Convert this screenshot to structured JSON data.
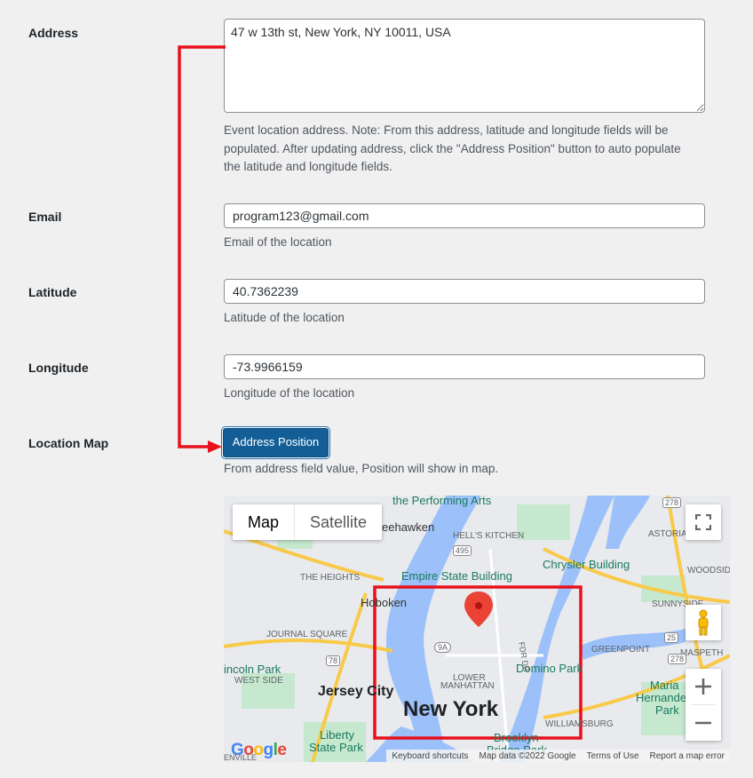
{
  "address": {
    "label": "Address",
    "value": "47 w 13th st, New York, NY 10011, USA",
    "desc_lines": [
      "Event location address. Note: From this address, latitude and longitude fields will be",
      "populated. After updating address, click the \"Address Position\" button to auto populate",
      "the latitude and longitude fields."
    ]
  },
  "email": {
    "label": "Email",
    "value": "program123@gmail.com",
    "desc": "Email of the location"
  },
  "latitude": {
    "label": "Latitude",
    "value": "40.7362239",
    "desc": "Latitude of the location"
  },
  "longitude": {
    "label": "Longitude",
    "value": "-73.9966159",
    "desc": "Longitude of the location"
  },
  "location_map": {
    "label": "Location Map",
    "button_label": "Address Position",
    "desc": "From address field value, Position will show in map."
  },
  "map": {
    "type_map": "Map",
    "type_satellite": "Satellite",
    "labels": {
      "performing_arts": "the Performing Arts",
      "weehawken": "eehawken",
      "hells_kitchen": "HELL'S KITCHEN",
      "empire": "Empire State Building",
      "chrysler": "Chrysler Building",
      "heights": "THE HEIGHTS",
      "hoboken": "Hoboken",
      "journal_square": "JOURNAL SQUARE",
      "lincoln_park": "incoln Park",
      "west_side": "WEST SIDE",
      "jersey_city": "Jersey City",
      "lower_manhattan_1": "LOWER",
      "lower_manhattan_2": "MANHATTAN",
      "new_york": "New York",
      "domino": "Domino Park",
      "greenpoint": "GREENPOINT",
      "williamsburg": "WILLIAMSBURG",
      "astoria": "ASTORIA",
      "woodside": "WOODSIDE",
      "sunnyside": "SUNNYSIDE",
      "maspeth": "MASPETH",
      "maria_1": "Maria",
      "maria_2": "Hernande",
      "maria_3": "Park",
      "liberty_1": "Liberty",
      "liberty_2": "State Park",
      "brooklyn_1": "Brooklyn",
      "brooklyn_2": "Bridge Park",
      "fdr": "FDR DR",
      "enville": "ENVILLE",
      "r495": "495",
      "r278a": "278",
      "r278b": "278",
      "r9a": "9A",
      "r78": "78",
      "r25": "25"
    },
    "google": "Google",
    "footer": {
      "shortcuts": "Keyboard shortcuts",
      "data": "Map data ©2022 Google",
      "terms": "Terms of Use",
      "report": "Report a map error"
    }
  },
  "colors": {
    "annotation": "#e8111b",
    "button": "#135e96",
    "water": "#9cc0f9",
    "park": "#a8dab5"
  }
}
